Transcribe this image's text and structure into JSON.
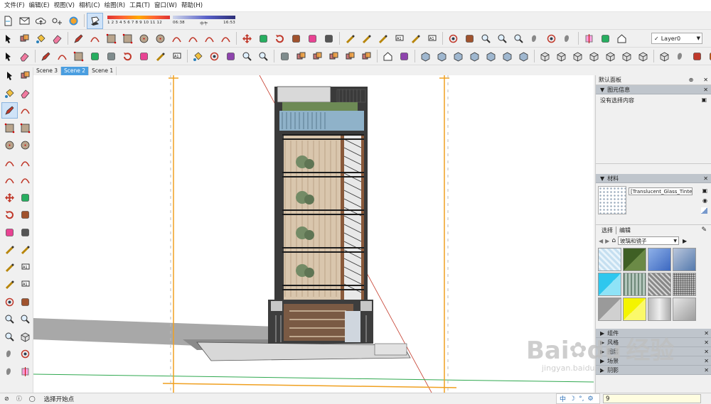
{
  "menubar": {
    "items": [
      "文件(F)",
      "编辑(E)",
      "视图(V)",
      "相机(C)",
      "绘图(R)",
      "工具(T)",
      "窗口(W)",
      "帮助(H)"
    ]
  },
  "toolbar": {
    "shadow_months": "1 2 3 4 5 6 7 8 9 10 11 12",
    "shadow_time_start": "06:38",
    "shadow_time_mid": "中午",
    "shadow_time_end": "16:53",
    "layer_label": "Layer0",
    "layer_check": "✓"
  },
  "scenes": {
    "tabs": [
      "Scene 3",
      "Scene 2",
      "Scene 1"
    ],
    "active_index": 1
  },
  "tray": {
    "title": "默认面板",
    "entity_info": {
      "header": "图元信息",
      "empty_text": "没有选择内容"
    },
    "materials": {
      "header": "材料",
      "current_name": "[Translucent_Glass_Tinted]",
      "tab_select": "选择",
      "tab_edit": "编辑",
      "library": "玻璃和镜子"
    },
    "collapsed": [
      "组件",
      "风格",
      "图层",
      "场景",
      "阴影"
    ]
  },
  "status": {
    "prompt": "选择开始点",
    "measure_value": "9"
  },
  "ime": {
    "mode": "中",
    "moon": "☽",
    "punct": "°,",
    "gear": "⚙"
  },
  "watermark": {
    "logo": "Bai",
    "logo_mid": "du",
    "brand": "经验",
    "url": "jingyan.baidu.com"
  },
  "colors": {
    "accent": "#4a9ee0",
    "guide_orange": "#f0a020",
    "axis_green": "#2fa84f",
    "axis_red": "#c43a2a",
    "panel_header": "#bfc5cc"
  },
  "icons": {
    "row1": [
      "select-icon",
      "make-component-icon",
      "paint-bucket-icon",
      "eraser-icon",
      "pencil-icon",
      "freehand-icon",
      "rectangle-icon",
      "rotated-rectangle-icon",
      "circle-icon",
      "polygon-icon",
      "arc-icon",
      "two-point-arc-icon",
      "three-point-arc-icon",
      "pie-icon",
      "move-icon",
      "push-pull-icon",
      "rotate-icon",
      "follow-me-icon",
      "scale-icon",
      "offset-icon",
      "tape-measure-icon",
      "dimension-icon",
      "protractor-icon",
      "text-icon",
      "axes-icon",
      "3d-text-icon",
      "orbit-icon",
      "pan-icon",
      "zoom-icon",
      "zoom-window-icon",
      "zoom-extents-icon",
      "position-camera-icon",
      "look-around-icon",
      "walk-icon",
      "section-plane-icon",
      "x-ray-icon",
      "back-edges-icon"
    ],
    "row2": [
      "select-icon",
      "eraser-icon",
      "pencil-icon",
      "arc-icon",
      "rectangle-icon",
      "push-pull-icon",
      "follow-me-icon",
      "rotate-icon",
      "scale-icon",
      "tape-measure-icon",
      "text-icon",
      "paint-bucket-icon",
      "orbit-icon",
      "pan-icon",
      "zoom-icon",
      "zoom-extents-icon",
      "sandbox-icon",
      "component-icon",
      "solid-tools-icon",
      "outer-shell-icon",
      "union-icon",
      "subtract-icon",
      "warehouse-icon",
      "extension-icon",
      "style-icon",
      "xray-style-icon",
      "wireframe-icon",
      "hidden-line-icon",
      "shaded-icon",
      "textured-icon",
      "monochrome-icon",
      "iso-view-icon",
      "top-view-icon",
      "front-view-icon",
      "right-view-icon",
      "back-view-icon",
      "left-view-icon",
      "perspective-icon",
      "parallel-icon",
      "camera-icon",
      "layer-icon",
      "outliner-icon"
    ],
    "sidebar": [
      "select-icon",
      "make-component-icon",
      "paint-bucket-icon",
      "eraser-icon",
      "pencil-icon",
      "freehand-icon",
      "rectangle-icon",
      "rotated-rectangle-icon",
      "circle-icon",
      "polygon-icon",
      "arc-icon",
      "two-point-arc-icon",
      "three-point-arc-icon",
      "pie-icon",
      "move-icon",
      "push-pull-icon",
      "rotate-icon",
      "follow-me-icon",
      "scale-icon",
      "offset-icon",
      "tape-measure-icon",
      "dimension-icon",
      "protractor-icon",
      "text-icon",
      "axes-icon",
      "3d-text-icon",
      "orbit-icon",
      "pan-icon",
      "zoom-icon",
      "zoom-window-icon",
      "zoom-extents-icon",
      "previous-view-icon",
      "position-camera-icon",
      "look-around-icon",
      "walk-icon",
      "section-plane-icon"
    ]
  }
}
